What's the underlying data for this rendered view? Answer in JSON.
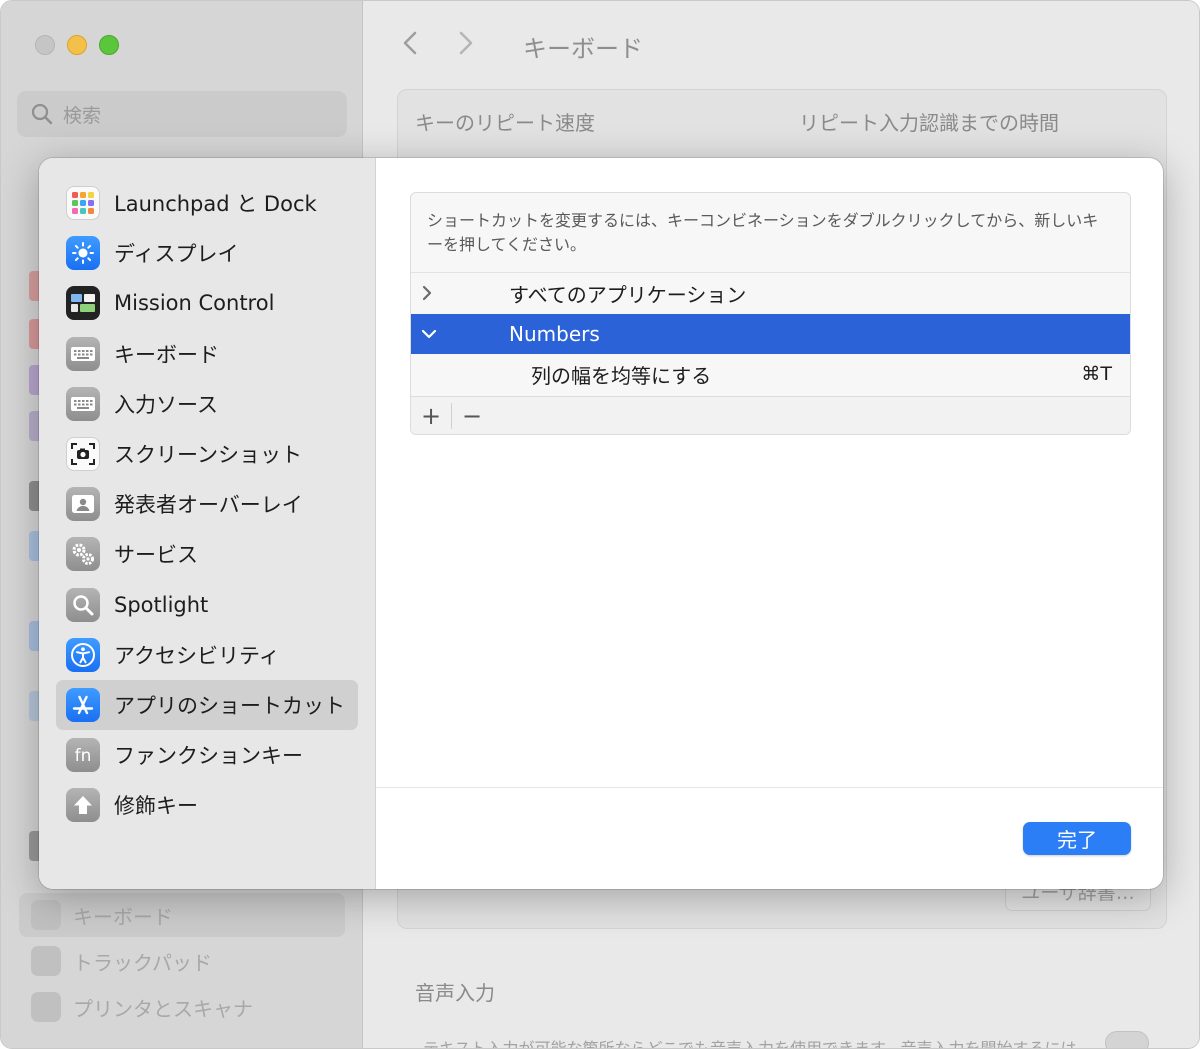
{
  "background_window": {
    "search_placeholder": "検索",
    "title": "キーボード",
    "key_repeat_label": "キーのリピート速度",
    "repeat_delay_label": "リピート入力認識までの時間",
    "sidebar_bottom_items": [
      {
        "label": "キーボード",
        "selected": true
      },
      {
        "label": "トラックパッド",
        "selected": false
      },
      {
        "label": "プリンタとスキャナ",
        "selected": false
      }
    ],
    "user_dictionary_button": "ユーザ辞書…",
    "voice_input_heading": "音声入力",
    "voice_input_description": "テキスト入力が可能な箇所ならどこでも音声入力を使用できます。音声入力を開始するには"
  },
  "sheet": {
    "sidebar": {
      "items": [
        {
          "label": "Launchpad と Dock",
          "icon": "launchpad-icon"
        },
        {
          "label": "ディスプレイ",
          "icon": "display-icon"
        },
        {
          "label": "Mission Control",
          "icon": "mission-control-icon"
        },
        {
          "label": "キーボード",
          "icon": "keyboard-icon"
        },
        {
          "label": "入力ソース",
          "icon": "input-source-icon"
        },
        {
          "label": "スクリーンショット",
          "icon": "screenshot-icon"
        },
        {
          "label": "発表者オーバーレイ",
          "icon": "presenter-overlay-icon"
        },
        {
          "label": "サービス",
          "icon": "services-icon"
        },
        {
          "label": "Spotlight",
          "icon": "spotlight-icon"
        },
        {
          "label": "アクセシビリティ",
          "icon": "accessibility-icon"
        },
        {
          "label": "アプリのショートカット",
          "icon": "app-shortcuts-icon",
          "selected": true
        },
        {
          "label": "ファンクションキー",
          "icon": "function-keys-icon"
        },
        {
          "label": "修飾キー",
          "icon": "modifier-keys-icon"
        }
      ]
    },
    "description": "ショートカットを変更するには、キーコンビネーションをダブルクリックしてから、新しいキーを押してください。",
    "rows": {
      "all_apps": "すべてのアプリケーション",
      "numbers": "Numbers",
      "shortcut_name": "列の幅を均等にする",
      "shortcut_keys": "⌘T"
    },
    "add_label": "+",
    "remove_label": "−",
    "done_label": "完了",
    "colors": {
      "selection": "#2c62d8",
      "done_button": "#2b7ef5"
    }
  }
}
